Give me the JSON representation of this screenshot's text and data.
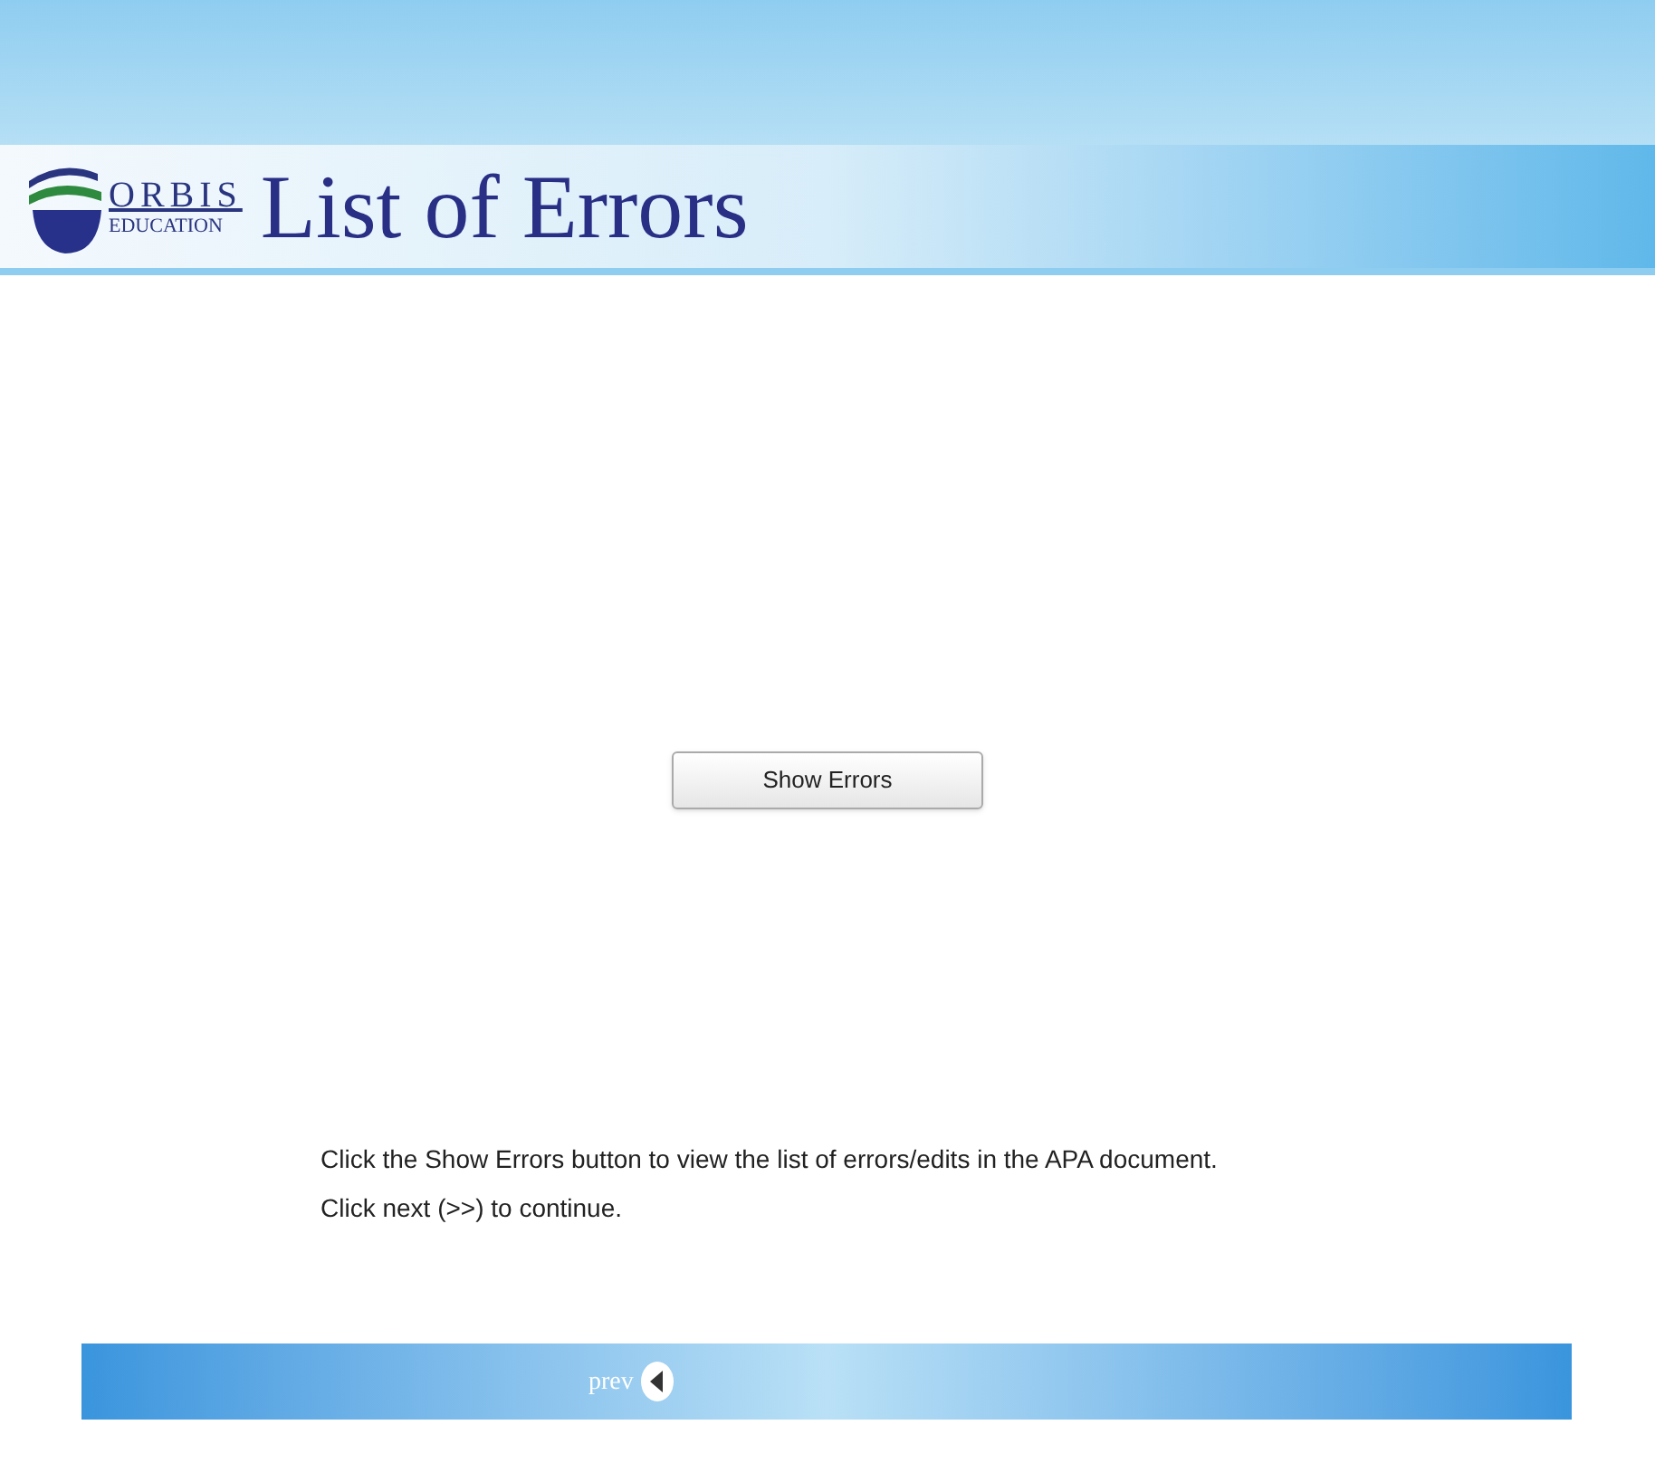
{
  "header": {
    "logo_top": "ORBIS",
    "logo_bottom": "EDUCATION",
    "title": "List of Errors"
  },
  "button": {
    "label": "Show Errors"
  },
  "instructions": [
    "Click the Show Errors button to view the list of errors/edits in the APA document.",
    "Click next (>>) to continue."
  ],
  "footer": {
    "prev": "prev"
  }
}
